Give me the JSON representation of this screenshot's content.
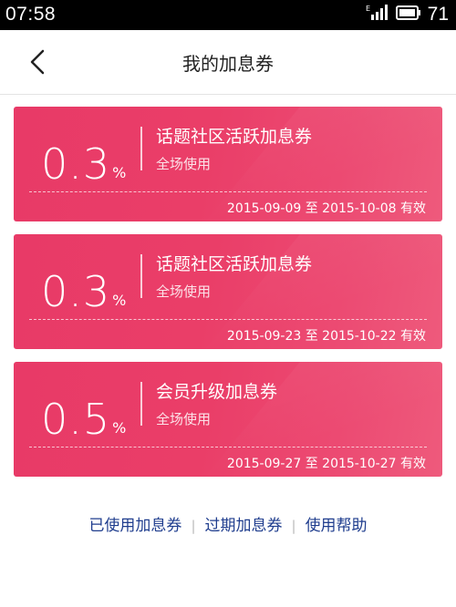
{
  "status_bar": {
    "time": "07:58",
    "network": "E",
    "battery_level": "71"
  },
  "header": {
    "title": "我的加息券"
  },
  "coupons": [
    {
      "rate": "0.3",
      "unit": "%",
      "name": "话题社区活跃加息券",
      "scope": "全场使用",
      "validity": "2015-09-09 至 2015-10-08 有效"
    },
    {
      "rate": "0.3",
      "unit": "%",
      "name": "话题社区活跃加息券",
      "scope": "全场使用",
      "validity": "2015-09-23 至 2015-10-22 有效"
    },
    {
      "rate": "0.5",
      "unit": "%",
      "name": "会员升级加息券",
      "scope": "全场使用",
      "validity": "2015-09-27 至 2015-10-27 有效"
    }
  ],
  "footer": {
    "used_label": "已使用加息券",
    "expired_label": "过期加息券",
    "help_label": "使用帮助",
    "separator": "|"
  }
}
